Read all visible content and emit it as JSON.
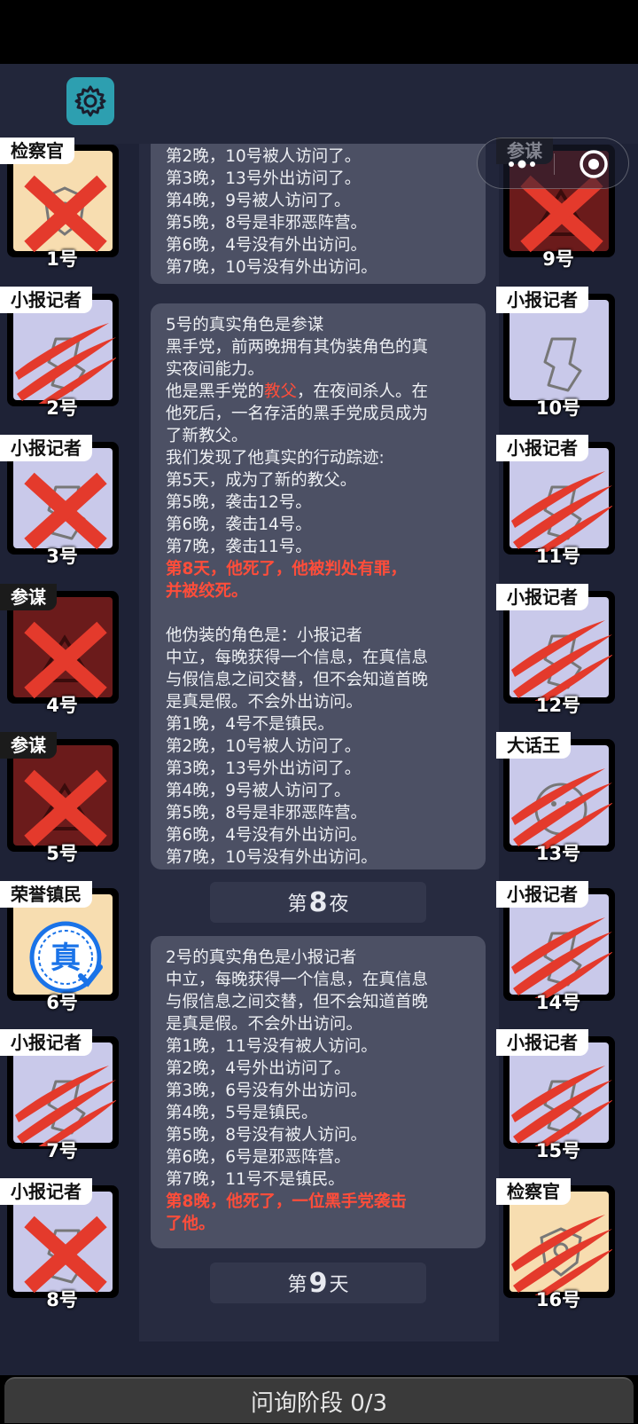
{
  "header": {
    "settings_icon": "gear-icon",
    "capsule_more_icon": "more-dots-icon",
    "capsule_close_icon": "target-close-icon"
  },
  "left_players": [
    {
      "role": "检察官",
      "number": "1号",
      "status": "crossed",
      "bg": "#f7ddb0"
    },
    {
      "role": "小报记者",
      "number": "2号",
      "status": "clawed",
      "bg": "#c9c9ea"
    },
    {
      "role": "小报记者",
      "number": "3号",
      "status": "crossed",
      "bg": "#c9c9ea"
    },
    {
      "role": "参谋",
      "number": "4号",
      "status": "crossed",
      "bg": "#6b1b1b"
    },
    {
      "role": "参谋",
      "number": "5号",
      "status": "crossed",
      "bg": "#6b1b1b"
    },
    {
      "role": "荣誉镇民",
      "number": "6号",
      "status": "alive",
      "bg": "#f7ddb0"
    },
    {
      "role": "小报记者",
      "number": "7号",
      "status": "clawed",
      "bg": "#c9c9ea"
    },
    {
      "role": "小报记者",
      "number": "8号",
      "status": "crossed",
      "bg": "#c9c9ea"
    }
  ],
  "right_players": [
    {
      "role": "参谋",
      "number": "9号",
      "status": "crossed",
      "bg": "#6b1b1b"
    },
    {
      "role": "小报记者",
      "number": "10号",
      "status": "alive",
      "bg": "#c9c9ea"
    },
    {
      "role": "小报记者",
      "number": "11号",
      "status": "clawed",
      "bg": "#c9c9ea"
    },
    {
      "role": "小报记者",
      "number": "12号",
      "status": "clawed",
      "bg": "#c9c9ea"
    },
    {
      "role": "大话王",
      "number": "13号",
      "status": "clawed",
      "bg": "#c9c9ea"
    },
    {
      "role": "小报记者",
      "number": "14号",
      "status": "clawed",
      "bg": "#c9c9ea"
    },
    {
      "role": "小报记者",
      "number": "15号",
      "status": "clawed",
      "bg": "#c9c9ea"
    },
    {
      "role": "检察官",
      "number": "16号",
      "status": "clawed",
      "bg": "#f7ddb0"
    }
  ],
  "log": {
    "bubble1_lines": [
      "第2晚，10号被人访问了。",
      "第3晚，13号外出访问了。",
      "第4晚，9号被人访问了。",
      "第5晚，8号是非邪恶阵营。",
      "第6晚，4号没有外出访问。",
      "第7晚，10号没有外出访问。"
    ],
    "bubble2": {
      "l1": "5号的真实角色是参谋",
      "l2": "黑手党，前两晚拥有其伪装角色的真",
      "l3": "实夜间能力。",
      "l4a": "他是黑手党的",
      "l4b": "教父",
      "l4c": "，在夜间杀人。在",
      "l5": "他死后，一名存活的黑手党成员成为",
      "l6": "了新教父。",
      "l7": "我们发现了他真实的行动踪迹:",
      "l8": "第5天，成为了新的教父。",
      "l9": "第5晚，袭击12号。",
      "l10": "第6晚，袭击14号。",
      "l11": "第7晚，袭击11号。",
      "r1": "第8天，他死了，他被判处有罪，",
      "r2": "并被绞死。",
      "l12": "他伪装的角色是：小报记者",
      "l13": "中立，每晚获得一个信息，在真信息",
      "l14": "与假信息之间交替，但不会知道首晚",
      "l15": "是真是假。不会外出访问。",
      "l16": "第1晚，4号不是镇民。",
      "l17": "第2晚，10号被人访问了。",
      "l18": "第3晚，13号外出访问了。",
      "l19": "第4晚，9号被人访问了。",
      "l20": "第5晚，8号是非邪恶阵营。",
      "l21": "第6晚，4号没有外出访问。",
      "l22": "第7晚，10号没有外出访问。"
    },
    "night_divider": {
      "pre": "第",
      "num": "8",
      "post": "夜"
    },
    "bubble3": {
      "l1": "2号的真实角色是小报记者",
      "l2": "中立，每晚获得一个信息，在真信息",
      "l3": "与假信息之间交替，但不会知道首晚",
      "l4": "是真是假。不会外出访问。",
      "l5": "第1晚，11号没有被人访问。",
      "l6": "第2晚，4号外出访问了。",
      "l7": "第3晚，6号没有外出访问。",
      "l8": "第4晚，5号是镇民。",
      "l9": "第5晚，8号没有被人访问。",
      "l10": "第6晚，6号是邪恶阵营。",
      "l11": "第7晚，11号不是镇民。",
      "r1": "第8晚，他死了，一位黑手党袭击",
      "r2": "了他。"
    },
    "day_divider": {
      "pre": "第",
      "num": "9",
      "post": "天"
    }
  },
  "bottom": {
    "phase_label": "问询阶段 0/3"
  },
  "colors": {
    "kill_red": "#ff4d3a",
    "cross_red": "#e43a2c",
    "teal": "#2d9fb0"
  }
}
